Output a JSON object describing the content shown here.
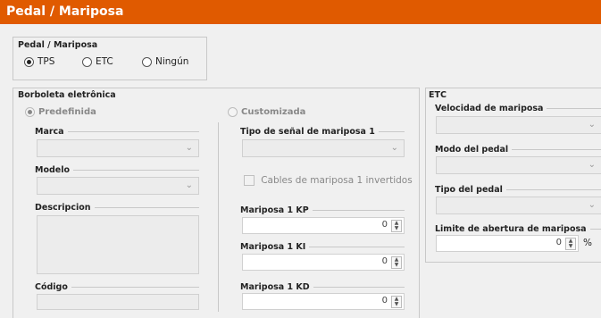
{
  "title": "Pedal / Mariposa",
  "pedal_group": {
    "title": "Pedal / Mariposa",
    "options": [
      "TPS",
      "ETC",
      "Ningún"
    ],
    "selected": "TPS"
  },
  "borboleta": {
    "title": "Borboleta eletrônica",
    "predefinida_label": "Predefinida",
    "customizada_label": "Customizada",
    "marca_label": "Marca",
    "modelo_label": "Modelo",
    "descripcion_label": "Descripcion",
    "codigo_label": "Código",
    "tipo_senal_label": "Tipo de señal de mariposa 1",
    "cables_label": "Cables de mariposa 1 invertidos",
    "kp_label": "Mariposa 1 KP",
    "kp_value": "0",
    "ki_label": "Mariposa 1 KI",
    "ki_value": "0",
    "kd_label": "Mariposa 1 KD",
    "kd_value": "0"
  },
  "etc": {
    "title": "ETC",
    "velocidad_label": "Velocidad de mariposa",
    "modo_label": "Modo del pedal",
    "tipo_label": "Tipo del pedal",
    "limite_label": "Limite de abertura de mariposa",
    "limite_value": "0",
    "limite_unit": "%"
  },
  "colors": {
    "titlebar": "#e05a00"
  }
}
